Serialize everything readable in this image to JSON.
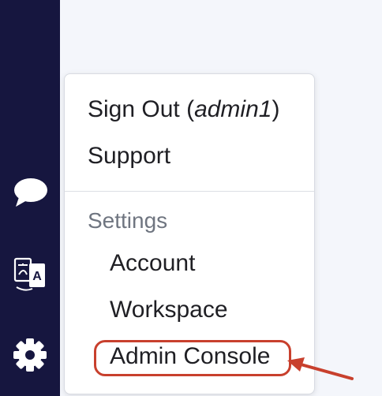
{
  "menu": {
    "sign_out_label": "Sign Out (",
    "sign_out_user": "admin1",
    "sign_out_close": ")",
    "support_label": "Support",
    "settings_header": "Settings",
    "account_label": "Account",
    "workspace_label": "Workspace",
    "admin_console_label": "Admin Console"
  },
  "sidebar": {
    "icons": [
      "chat-bubble-icon",
      "translate-icon",
      "gear-icon"
    ]
  },
  "colors": {
    "sidebar_bg": "#16163f",
    "highlight": "#c8402d"
  }
}
